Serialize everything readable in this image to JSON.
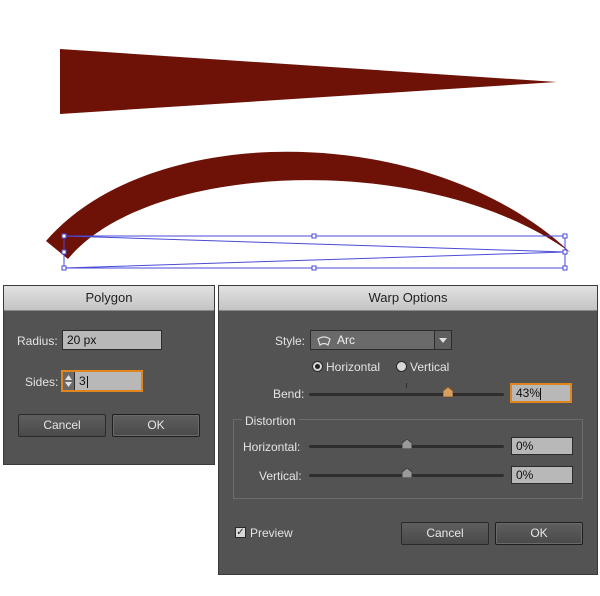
{
  "colors": {
    "shape_fill": "#6e1207",
    "selection": "#4a4ad8",
    "dialog_bg": "#535353",
    "focus": "#e0861d"
  },
  "polygon_dialog": {
    "title": "Polygon",
    "radius_label": "Radius:",
    "radius_value": "20 px",
    "sides_label": "Sides:",
    "sides_value": "3",
    "cancel_label": "Cancel",
    "ok_label": "OK"
  },
  "warp_dialog": {
    "title": "Warp Options",
    "style_label": "Style:",
    "style_value": "Arc",
    "orientation_options": {
      "horizontal": "Horizontal",
      "vertical": "Vertical",
      "selected": "horizontal"
    },
    "bend_label": "Bend:",
    "bend_value": "43%",
    "bend_percent": 43,
    "distortion_label": "Distortion",
    "h_distortion_label": "Horizontal:",
    "h_distortion_value": "0%",
    "h_distortion_percent": 0,
    "v_distortion_label": "Vertical:",
    "v_distortion_value": "0%",
    "v_distortion_percent": 0,
    "preview_label": "Preview",
    "preview_checked": true,
    "cancel_label": "Cancel",
    "ok_label": "OK",
    "icons": {
      "style_icon": "arc-warp-icon",
      "dropdown": "dropdown-arrow-icon"
    }
  }
}
